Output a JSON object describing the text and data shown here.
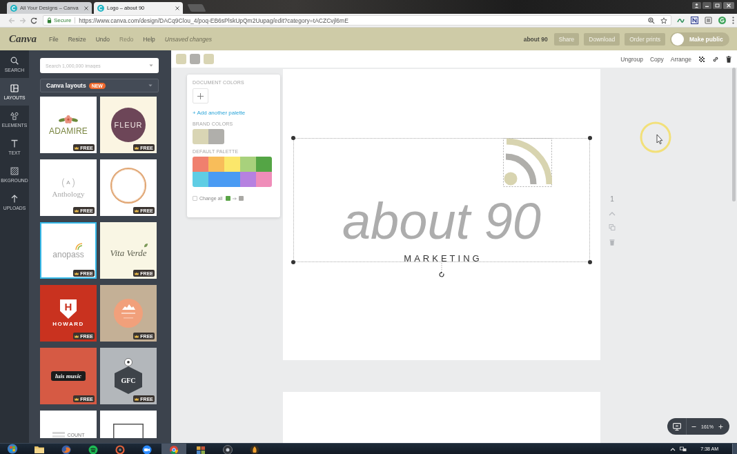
{
  "browser": {
    "tabs": [
      {
        "title": "All Your Designs – Canva",
        "selected": false
      },
      {
        "title": "Logo – about 90",
        "selected": true
      }
    ],
    "address_bar": {
      "security_label": "Secure",
      "url": "https://www.canva.com/design/DACq9Clou_4/poq-EB6sPlskUpQm2Uupag/edit?category=tACZCvjl6mE"
    }
  },
  "top_bar": {
    "logo": "Canva",
    "menu": [
      {
        "label": "File",
        "disabled": false
      },
      {
        "label": "Resize",
        "disabled": false
      },
      {
        "label": "Undo",
        "disabled": false
      },
      {
        "label": "Redo",
        "disabled": true
      },
      {
        "label": "Help",
        "disabled": false
      }
    ],
    "save_status": "Unsaved changes",
    "design_title": "about 90",
    "actions": [
      "Share",
      "Download",
      "Order prints"
    ],
    "make_public": {
      "label": "Make public",
      "on": false
    }
  },
  "sidebar": {
    "items": [
      {
        "label": "SEARCH",
        "selected": false
      },
      {
        "label": "LAYOUTS",
        "selected": true
      },
      {
        "label": "ELEMENTS",
        "selected": false
      },
      {
        "label": "TEXT",
        "selected": false
      },
      {
        "label": "BKGROUND",
        "selected": false
      },
      {
        "label": "UPLOADS",
        "selected": false
      }
    ]
  },
  "layouts_panel": {
    "search": {
      "placeholder": "Search 1,000,000 images"
    },
    "source": {
      "label": "Canva layouts",
      "badge": "NEW"
    },
    "thumbnails": [
      {
        "kind": "flower",
        "title": "ADAMIRE",
        "badge": "FREE",
        "selected": false
      },
      {
        "kind": "disc",
        "title": "FLEUR",
        "badge": "FREE",
        "selected": false
      },
      {
        "kind": "wreath",
        "monogram": "A",
        "title": "Anthology",
        "badge": "FREE",
        "selected": false
      },
      {
        "kind": "ring",
        "badge": "FREE",
        "selected": false
      },
      {
        "kind": "waves",
        "title": "anopass",
        "badge": "FREE",
        "selected": true
      },
      {
        "kind": "script",
        "title": "Vita Verde",
        "badge": "FREE",
        "selected": false
      },
      {
        "kind": "shield",
        "monogram": "H",
        "title": "HOWARD",
        "badge": "FREE",
        "selected": false
      },
      {
        "kind": "sun",
        "badge": "FREE",
        "selected": false
      },
      {
        "kind": "brush",
        "title": "luis music",
        "badge": "FREE",
        "selected": false
      },
      {
        "kind": "hexagon",
        "title": "GFC",
        "badge": "FREE",
        "selected": false
      },
      {
        "kind": "bars",
        "title": "COUNT",
        "selected": false
      },
      {
        "kind": "frame",
        "selected": false
      }
    ]
  },
  "color_toolbar": {
    "swatches": [
      {
        "color": "#d9d5b4"
      },
      {
        "color": "#b0afab"
      },
      {
        "color": "#d9d5b4"
      }
    ],
    "actions": [
      "Ungroup",
      "Copy",
      "Arrange"
    ]
  },
  "color_picker": {
    "document_heading": "DOCUMENT COLORS",
    "add_palette_link": "+ Add another palette",
    "brand_heading": "BRAND COLORS",
    "brand_colors": [
      {
        "color": "#d9d5b4"
      },
      {
        "color": "#b0afab"
      }
    ],
    "default_heading": "DEFAULT PALETTE",
    "default_palette": [
      {
        "color": "#f0806e"
      },
      {
        "color": "#f8bd5a"
      },
      {
        "color": "#fbe76b"
      },
      {
        "color": "#a8d17c"
      },
      {
        "color": "#54a545"
      },
      {
        "color": "#5fcde4"
      },
      {
        "color": "#4a9bf3"
      },
      {
        "color": "#4a9bf3"
      },
      {
        "color": "#b681e0"
      },
      {
        "color": "#ef8db9"
      }
    ],
    "change_all": {
      "label": "Change all",
      "checked": false,
      "swatches": [
        {
          "color": "#5aa447"
        },
        {
          "color": "#aaa9a5"
        }
      ]
    }
  },
  "canvas": {
    "logo": {
      "title": "about 90",
      "tagline": "MARKETING",
      "selected": true
    }
  },
  "page_tools": {
    "page_number": "1"
  },
  "zoom_control": {
    "value": "161%"
  },
  "taskbar": {
    "time": "7:38 AM"
  }
}
